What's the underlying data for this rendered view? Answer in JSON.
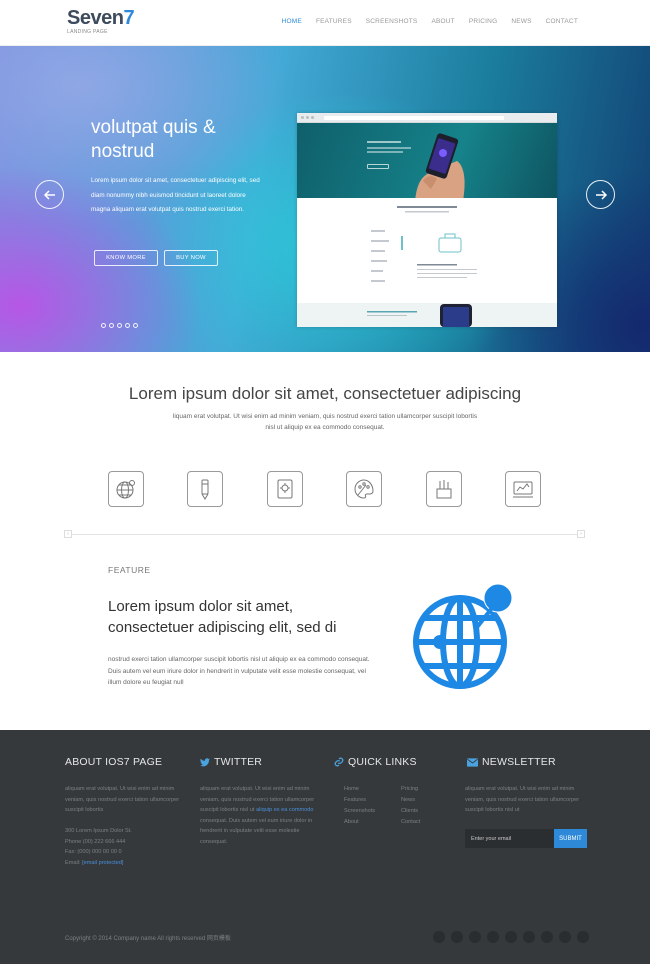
{
  "header": {
    "logo_title_main": "Seven",
    "logo_title_num": "7",
    "logo_subtitle": "LANDING PAGE",
    "nav": [
      "HOME",
      "FEATURES",
      "SCREENSHOTS",
      "ABOUT",
      "PRICING",
      "NEWS",
      "CONTACT"
    ],
    "active_nav": "HOME"
  },
  "hero": {
    "title": "volutpat quis & nostrud",
    "text": "Lorem ipsum dolor sit amet, consectetuer adipiscing elit, sed diam nonummy nibh euismod tincidunt ut laoreet dolore magna aliquam erat volutpat quis nostrud exerci tation.",
    "know_more_label": "KNOW MORE",
    "buy_now_label": "BUY NOW",
    "slide_count": 5,
    "active_slide": 1
  },
  "intro": {
    "title": "Lorem ipsum dolor sit amet, consectetuer adipiscing",
    "text": "liquam erat volutpat. Ut wisi enim ad minim veniam, quis nostrud exerci tation ullamcorper suscipit lobortis nisl ut aliquip ex ea commodo consequat."
  },
  "feature_icons": [
    "globe-icon",
    "pencil-icon",
    "tablet-icon",
    "palette-icon",
    "pens-icon",
    "chart-icon"
  ],
  "feature": {
    "label": "FEATURE",
    "title": "Lorem ipsum dolor sit amet, consectetuer adipiscing elit, sed di",
    "text": "nostrud exerci tation ullamcorper suscipit lobortis nisl ut aliquip ex ea commodo consequat. Duis autem vel eum iriure dolor in hendrerit in vulputate velit esse molestie consequat, vel illum dolore eu feugiat null"
  },
  "footer": {
    "about": {
      "heading": "ABOUT IOS7 PAGE",
      "text": "aliquam erat volutpat. Ut wisi enim ad minim veniam, quis nostrud exerci tation ullamcorper suscipit lobortis",
      "address": "300 Lorem Ipsum Dolor St.",
      "phone": "Phone (00) 222 666 444",
      "fax": "Fax: (000) 000 00 00 0",
      "email_label": "Email:",
      "email": "[email protected]"
    },
    "twitter": {
      "heading": "TWITTER",
      "text_a": "aliquam erat volutpat. Ut wisi enim ad minim veniam, quis nostrud exerci tation ullamcorper suscipit lobortis nisl ut",
      "link": "aliquip ex ea commodo",
      "text_b": "consequat. Duis autem vel eum iriure dolor in hendrerit in vulputate velit esse molestie consequat."
    },
    "quick_links": {
      "heading": "QUICK LINKS",
      "col1": [
        "Home",
        "Features",
        "Screenshots",
        "About"
      ],
      "col2": [
        "Pricing",
        "News",
        "Clients",
        "Contact"
      ]
    },
    "newsletter": {
      "heading": "NEWSLETTER",
      "text": "aliquam erat volutpat. Ut wisi enim ad minim veniam, quis nostrud exerci tation ullamcorper suscipit lobortis nisl ut",
      "placeholder": "Enter your email",
      "submit_label": "SUBMIT"
    },
    "copyright": "Copyright © 2014 Company name All rights reserved 网页模板",
    "social_icons": [
      "facebook-icon",
      "twitter-icon",
      "google-plus-icon",
      "linkedin-icon",
      "youtube-icon",
      "dribbble-icon",
      "pinterest-icon",
      "flickr-icon",
      "rss-icon"
    ]
  },
  "colors": {
    "accent": "#2e8ad8",
    "footer_bg": "#35393c",
    "heading": "#454545"
  }
}
